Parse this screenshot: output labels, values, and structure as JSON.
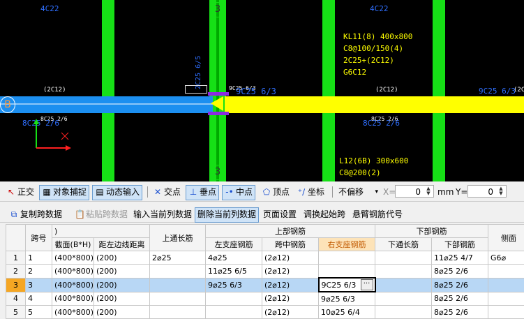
{
  "canvas": {
    "labels": {
      "col_top_left": "4C22",
      "col_top_right": "4C22",
      "axis_3_top": "3",
      "axis_3_bottom": "3",
      "axis_b": "B",
      "c25_vertical": "2C25 6/5",
      "beam_left_c12": "(2C12)",
      "beam_mid_c12": "(2C12)",
      "beam_right_c12": "(2C12)",
      "beam_right_c12b": "(2C",
      "support_rebar": "9C25 6/3",
      "support_rebar_small": "9C25 6/3",
      "support_rebar_right": "9C25 6/3",
      "bottom_left_small": "8C25 2/6",
      "bottom_left_big": "8C25 2/6",
      "bottom_mid_small": "8C25 2/6",
      "bottom_mid_big": "8C25 2/6",
      "kl_line1": "KL11(8) 400x800",
      "kl_line2": "C8@100/150(4)",
      "kl_line3": "2C25+(2C12)",
      "kl_line4": "G6C12",
      "l12_line1": "L12(6B) 300x600",
      "l12_line2": "C8@200(2)"
    }
  },
  "toolbar1": {
    "orthogonal": "正交",
    "object_snap": "对象捕捉",
    "dynamic_input": "动态输入",
    "intersection": "交点",
    "perpendicular": "垂点",
    "midpoint": "中点",
    "vertex": "顶点",
    "coordinate": "坐标",
    "offset_select": "不偏移",
    "x_label": "X=",
    "x_value": "0",
    "unit_mm": "mm",
    "y_label": "Y=",
    "y_value": "0"
  },
  "toolbar2": {
    "copy_span": "复制跨数据",
    "paste_span": "粘贴跨数据",
    "input_col": "输入当前列数据",
    "delete_col": "删除当前列数据",
    "page_setup": "页面设置",
    "adjust_start": "调换起始跨",
    "cantilever": "悬臂钢筋代号"
  },
  "grid": {
    "headers": {
      "span_no": "跨号",
      "section": "截面(B*H)",
      "distance": "距左边线距离",
      "top_through": "上通长筋",
      "top_group": "上部钢筋",
      "left_support": "左支座钢筋",
      "mid_span": "跨中钢筋",
      "right_support": "右支座钢筋",
      "bottom_group": "下部钢筋",
      "bottom_through": "下通长筋",
      "bottom_rebar": "下部钢筋",
      "side": "侧面",
      "group_left_stub": ")"
    },
    "rows": [
      {
        "rn": "1",
        "span": "1",
        "section": "(400*800)",
        "dist": "(200)",
        "top": "2⌀25",
        "left": "4⌀25",
        "mid": "(2⌀12)",
        "right": "",
        "bthrough": "",
        "bottom": "11⌀25 4/7",
        "side": "G6⌀"
      },
      {
        "rn": "2",
        "span": "2",
        "section": "(400*800)",
        "dist": "(200)",
        "top": "",
        "left": "11⌀25 6/5",
        "mid": "(2⌀12)",
        "right": "",
        "bthrough": "",
        "bottom": "8⌀25 2/6",
        "side": ""
      },
      {
        "rn": "3",
        "span": "3",
        "section": "(400*800)",
        "dist": "(200)",
        "top": "",
        "left": "9⌀25 6/3",
        "mid": "(2⌀12)",
        "right": "9C25 6/3",
        "bthrough": "",
        "bottom": "8⌀25 2/6",
        "side": ""
      },
      {
        "rn": "4",
        "span": "4",
        "section": "(400*800)",
        "dist": "(200)",
        "top": "",
        "left": "",
        "mid": "(2⌀12)",
        "right": "9⌀25 6/3",
        "bthrough": "",
        "bottom": "8⌀25 2/6",
        "side": ""
      },
      {
        "rn": "5",
        "span": "5",
        "section": "(400*800)",
        "dist": "(200)",
        "top": "",
        "left": "",
        "mid": "(2⌀12)",
        "right": "10⌀25 6/4",
        "bthrough": "",
        "bottom": "8⌀25 2/6",
        "side": ""
      }
    ]
  }
}
